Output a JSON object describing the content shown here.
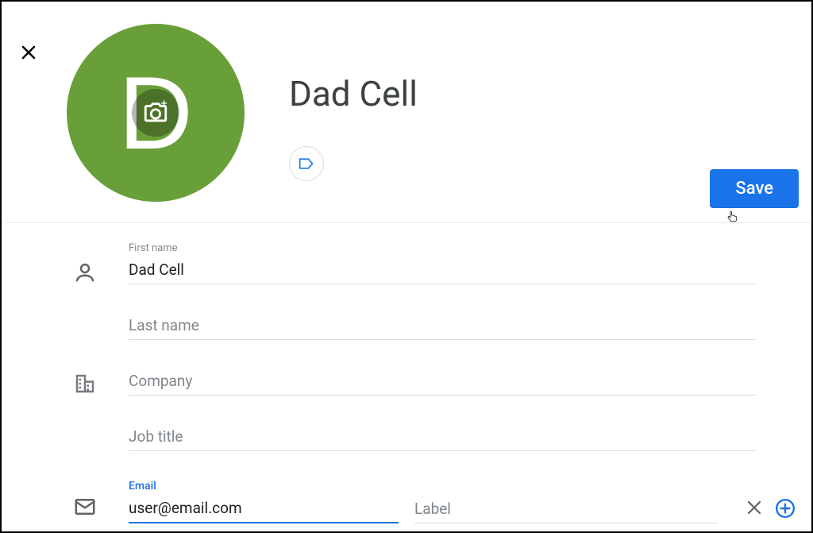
{
  "contact": {
    "name": "Dad Cell",
    "avatar_letter": "D"
  },
  "buttons": {
    "save": "Save"
  },
  "fields": {
    "first_name": {
      "label": "First name",
      "value": "Dad Cell"
    },
    "last_name": {
      "placeholder": "Last name",
      "value": ""
    },
    "company": {
      "placeholder": "Company",
      "value": ""
    },
    "job_title": {
      "placeholder": "Job title",
      "value": ""
    },
    "email": {
      "label": "Email",
      "value": "user@email.com",
      "label_placeholder": "Label"
    }
  },
  "colors": {
    "avatar_bg": "#689f38",
    "primary": "#1a73e8"
  }
}
